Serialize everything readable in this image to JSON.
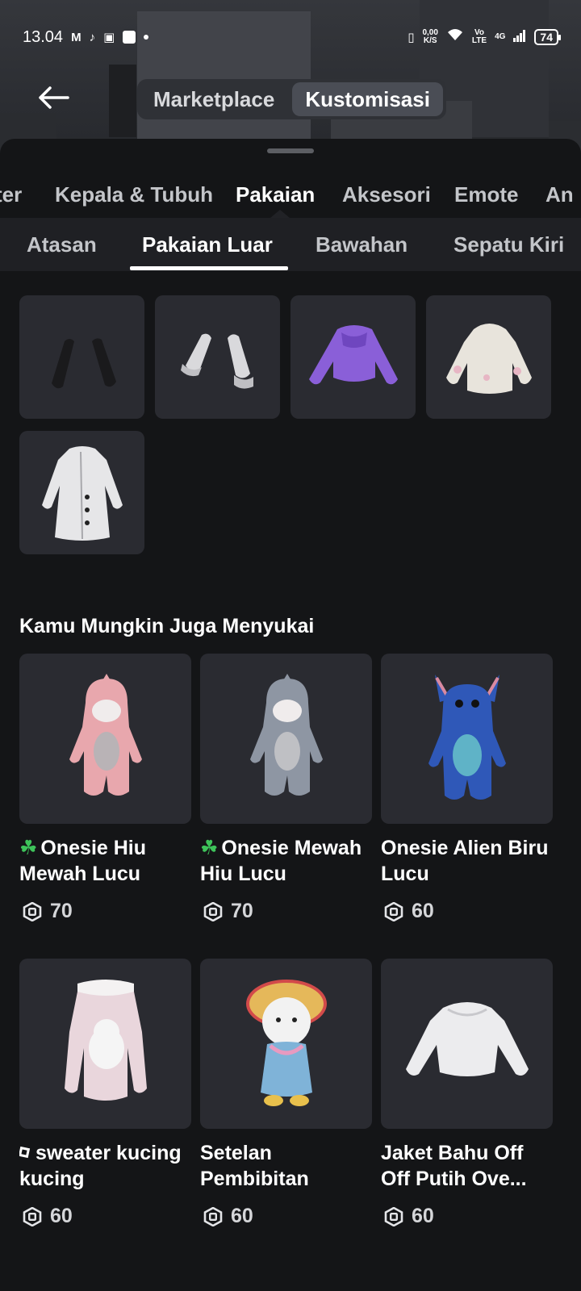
{
  "status_bar": {
    "time": "13.04",
    "net_speed_top": "0,00",
    "net_speed_unit": "K/S",
    "volte_top": "Vo",
    "volte_bottom": "LTE",
    "network": "4G",
    "battery": "74"
  },
  "nav": {
    "tabs": [
      {
        "label": "Marketplace",
        "active": false
      },
      {
        "label": "Kustomisasi",
        "active": true
      }
    ]
  },
  "categories": [
    {
      "label": "ter",
      "active": false
    },
    {
      "label": "Kepala & Tubuh",
      "active": false
    },
    {
      "label": "Pakaian",
      "active": true
    },
    {
      "label": "Aksesori",
      "active": false
    },
    {
      "label": "Emote",
      "active": false
    },
    {
      "label": "An",
      "active": false
    }
  ],
  "subcategories": [
    {
      "label": "Atasan",
      "active": false
    },
    {
      "label": "Pakaian Luar",
      "active": true
    },
    {
      "label": "Bawahan",
      "active": false
    },
    {
      "label": "Sepatu Kiri",
      "active": false
    }
  ],
  "owned_items": [
    {
      "icon": "black-arm-warmers-icon"
    },
    {
      "icon": "white-ruffle-sleeves-icon"
    },
    {
      "icon": "purple-puffer-jacket-icon"
    },
    {
      "icon": "cream-hoodie-icon"
    },
    {
      "icon": "white-trench-coat-icon"
    }
  ],
  "recommendations": {
    "heading": "Kamu Mungkin Juga Menyukai",
    "items": [
      {
        "prefix": "☘",
        "name": "Onesie Hiu Mewah Lucu",
        "price": "70",
        "icon": "pink-shark-onesie-icon"
      },
      {
        "prefix": "☘",
        "name": "Onesie Mewah Hiu Lucu",
        "price": "70",
        "icon": "grey-shark-onesie-icon"
      },
      {
        "prefix": "",
        "name": "Onesie Alien Biru Lucu",
        "price": "60",
        "icon": "blue-alien-onesie-icon"
      },
      {
        "prefix": "logo",
        "name": "sweater kucing kucing",
        "price": "60",
        "icon": "cat-sweater-icon"
      },
      {
        "prefix": "",
        "name": "Setelan Pembibitan",
        "price": "60",
        "icon": "kitten-outfit-icon"
      },
      {
        "prefix": "",
        "name": "Jaket Bahu Off Off Putih Ove...",
        "price": "60",
        "icon": "white-offshoulder-jacket-icon"
      }
    ]
  },
  "colors": {
    "background": "#111214",
    "tile": "#2a2b31",
    "subbar": "#1f2024",
    "accent_clover": "#3ec35a"
  }
}
